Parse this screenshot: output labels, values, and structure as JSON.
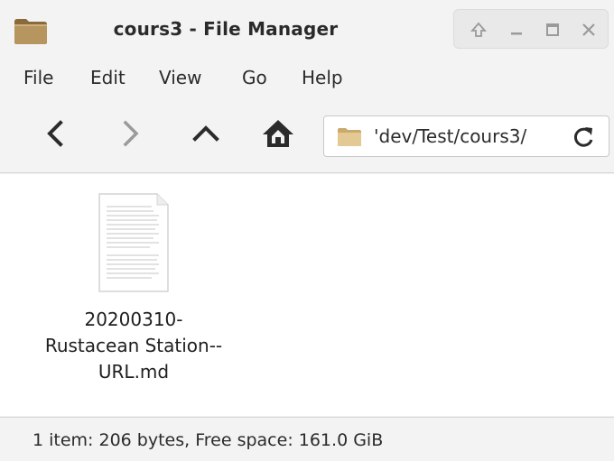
{
  "window": {
    "title": "cours3 - File Manager",
    "controls": [
      "up-arrow",
      "minimize",
      "maximize",
      "close"
    ]
  },
  "menubar": {
    "items": [
      "File",
      "Edit",
      "View",
      "Go",
      "Help"
    ]
  },
  "toolbar": {
    "location": "'dev/Test/cours3/"
  },
  "files": [
    {
      "name_lines": [
        "20200310-",
        "Rustacean Station--",
        "URL.md"
      ],
      "icon": "text-document-icon"
    }
  ],
  "statusbar": {
    "text": "1 item: 206 bytes, Free space: 161.0 GiB"
  },
  "colors": {
    "folder": "#b7955f",
    "chrome": "#f3f3f3",
    "content": "#ffffff",
    "icon_dark": "#2b2b2b",
    "icon_disabled": "#9a9a9a"
  }
}
